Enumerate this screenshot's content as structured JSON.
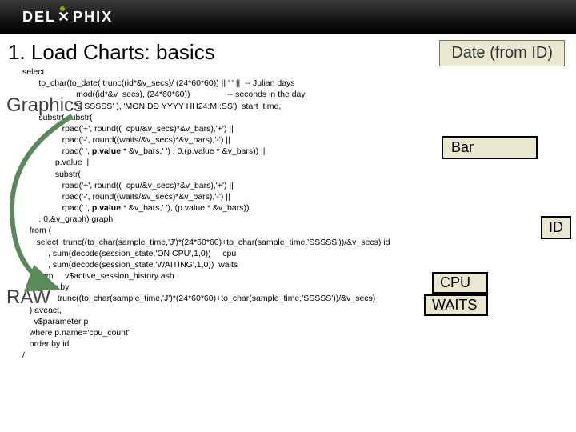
{
  "header": {
    "logo_prefix": "DEL",
    "logo_x": "✕",
    "logo_suffix": "PHIX"
  },
  "title": "1. Load Charts: basics",
  "date_badge": "Date (from ID)",
  "badges": {
    "bar": "Bar",
    "id": "ID",
    "cpu": "CPU",
    "waits": "WAITS"
  },
  "sections": {
    "graphics": "Graphics",
    "raw": "RAW"
  },
  "sql": {
    "l01": "select",
    "l02": "       to_char(to_date( trunc((id*&v_secs)/ (24*60*60)) || ' ' ||  -- Julian days",
    "l03": "                       mod((id*&v_secs), (24*60*60))                -- seconds in the day",
    "l04": "                     , 'J SSSSS' ), 'MON DD YYYY HH24:MI:SS')  start_time,",
    "l05": "       substr( substr(",
    "l06": "                 rpad('+', round((  cpu/&v_secs)*&v_bars),'+') ||",
    "l07": "                 rpad('-', round((waits/&v_secs)*&v_bars),'-') ||",
    "l08_a": "                 rpad(' ', ",
    "l08_b": "p.value",
    "l08_c": " * &v_bars,' ') , 0,(p.value * &v_bars)) ||",
    "l09": "              p.value  ||",
    "l10": "              substr(",
    "l11": "                 rpad('+', round((  cpu/&v_secs)*&v_bars),'+') ||",
    "l12": "                 rpad('-', round((waits/&v_secs)*&v_bars),'-') ||",
    "l13_a": "                 rpad(' ', ",
    "l13_b": "p.value",
    "l13_c": " * &v_bars,' '), (p.value * &v_bars))",
    "l14": "       , 0,&v_graph) graph",
    "l15": "   from (",
    "l16": "      select  trunc((to_char(sample_time,'J')*(24*60*60)+to_char(sample_time,'SSSSS'))/&v_secs) id",
    "l17": "           , sum(decode(session_state,'ON CPU',1,0))     cpu",
    "l18": "           , sum(decode(session_state,'WAITING',1,0))  waits",
    "l19": "      from     v$active_session_history ash",
    "l20": "      group by",
    "l21": "               trunc((to_char(sample_time,'J')*(24*60*60)+to_char(sample_time,'SSSSS'))/&v_secs)",
    "l22": "   ) aveact,",
    "l23": "     v$parameter p",
    "l24": "   where p.name='cpu_count'",
    "l25": "   order by id",
    "l26": "/"
  }
}
